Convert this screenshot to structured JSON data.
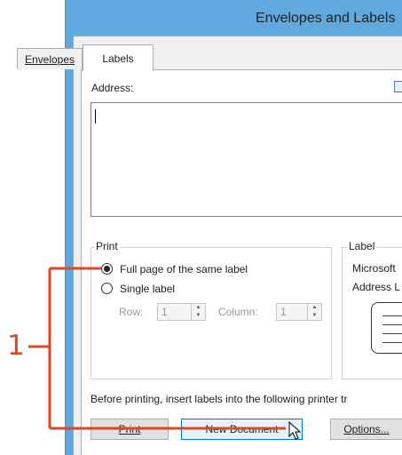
{
  "window": {
    "title": "Envelopes and Labels"
  },
  "tabs": [
    {
      "label": "Envelopes"
    },
    {
      "label": "Labels"
    }
  ],
  "address": {
    "label": "Address:",
    "value": ""
  },
  "print_group": {
    "title": "Print",
    "options": [
      {
        "label": "Full page of the same label",
        "checked": true
      },
      {
        "label": "Single label",
        "checked": false
      }
    ],
    "row": {
      "label": "Row:",
      "value": "1"
    },
    "column": {
      "label": "Column:",
      "value": "1"
    }
  },
  "label_group": {
    "title": "Label",
    "lines": [
      "Microsoft",
      "Address L"
    ]
  },
  "notice": "Before printing, insert labels into the following printer tr",
  "buttons": {
    "print": "Print",
    "new_document": "New Document",
    "options": "Options..."
  },
  "callout": {
    "number": "1",
    "color": "#d84a28"
  }
}
